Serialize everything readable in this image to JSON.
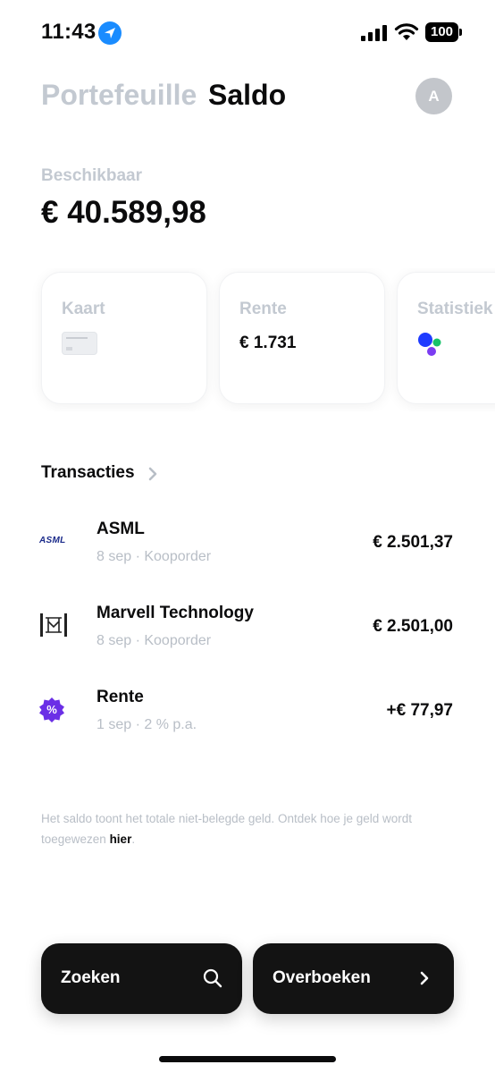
{
  "status_bar": {
    "time": "11:43",
    "battery": "100",
    "icons": [
      "location-arrow-icon",
      "cellular-signal-icon",
      "wifi-icon",
      "battery-icon"
    ]
  },
  "header": {
    "tab_portfolio": "Portefeuille",
    "tab_balance": "Saldo",
    "avatar_initial": "A"
  },
  "balance": {
    "label": "Beschikbaar",
    "amount": "€ 40.589,98"
  },
  "cards": [
    {
      "title": "Kaart",
      "icon": "card-thumbnail-icon"
    },
    {
      "title": "Rente",
      "value": "€ 1.731"
    },
    {
      "title": "Statistiek",
      "icon": "statistics-dots-icon"
    }
  ],
  "transactions": {
    "heading": "Transacties",
    "items": [
      {
        "name": "ASML",
        "meta": "8 sep · Kooporder",
        "amount": "€ 2.501,37",
        "logo_text": "ASML",
        "logo": "asml-logo"
      },
      {
        "name": "Marvell Technology",
        "meta": "8 sep · Kooporder",
        "amount": "€ 2.501,00",
        "logo": "marvell-logo"
      },
      {
        "name": "Rente",
        "meta": "1 sep · 2 % p.a.",
        "amount": "+€ 77,97",
        "logo_text": "%",
        "logo": "interest-badge-icon"
      }
    ]
  },
  "note": {
    "text": "Het saldo toont het totale niet-belegde geld. Ontdek hoe je geld wordt toegewezen ",
    "link": "hier",
    "suffix": "."
  },
  "actions": {
    "search_label": "Zoeken",
    "transfer_label": "Overboeken"
  },
  "colors": {
    "accent_blue": "#1a8cff",
    "stats_blue": "#1f3cff",
    "stats_green": "#18c26a",
    "stats_purple": "#7b3cf2",
    "rente_badge": "#6b2fe6",
    "asml_navy": "#1a2a8a",
    "muted": "#c3c9d1",
    "button_bg": "#131313"
  }
}
